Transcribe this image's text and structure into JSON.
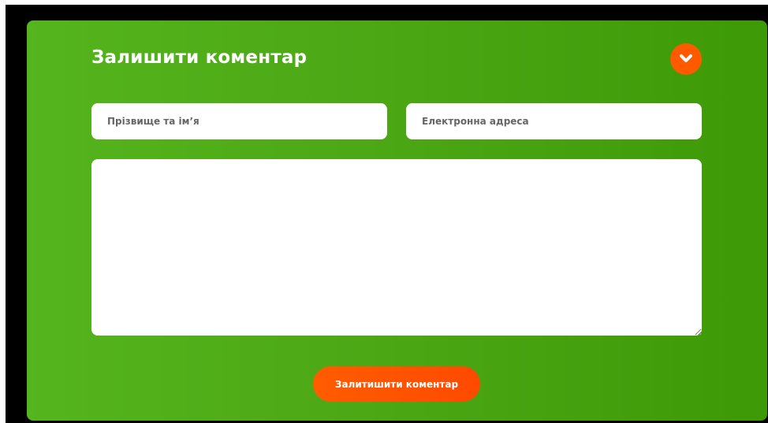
{
  "comment_form": {
    "title": "Залишити коментар",
    "toggle_icon": "chevron-down-icon",
    "name_placeholder": "Прізвище та ім’я",
    "email_placeholder": "Електронна адреса",
    "message_value": "",
    "submit_label": "Залитишити коментар"
  },
  "colors": {
    "panel_green": "#4aa513",
    "accent_orange": "#ff5a00",
    "field_white": "#ffffff"
  }
}
